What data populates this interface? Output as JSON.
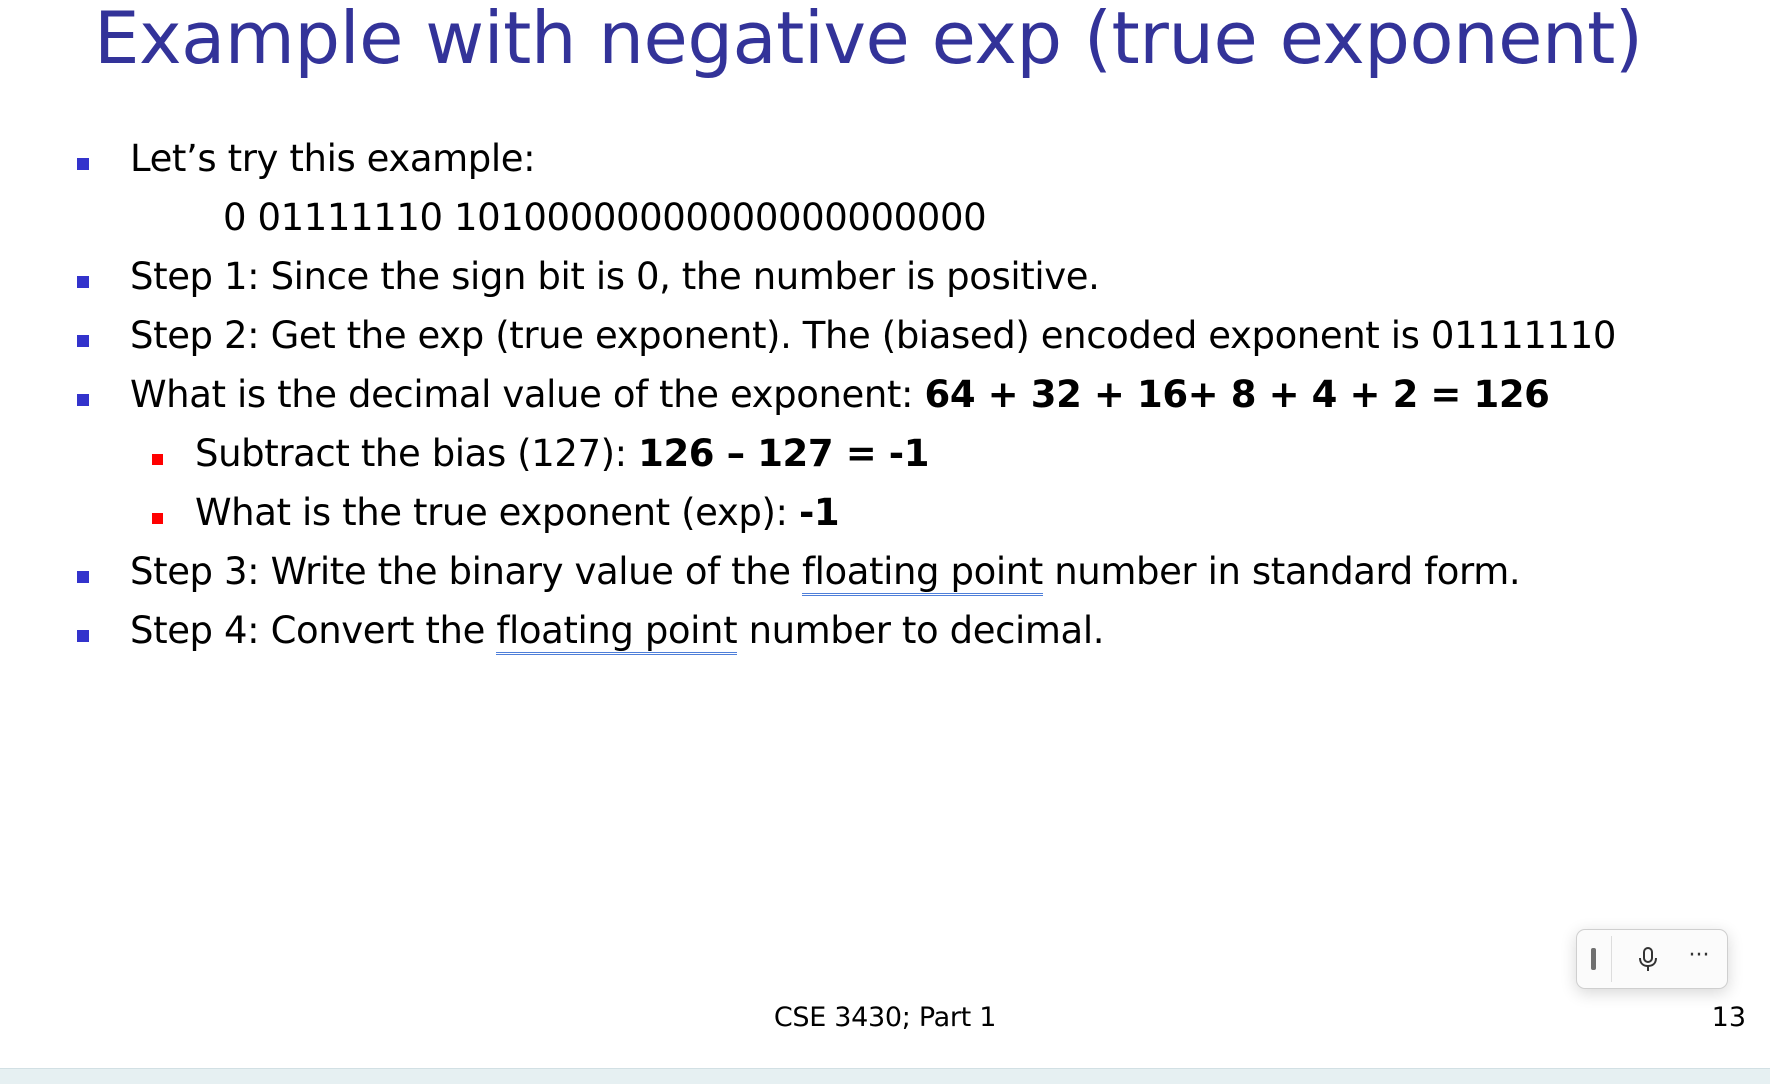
{
  "slide": {
    "title": "Example with negative exp (true exponent)",
    "bullets": {
      "b1": "Let’s try this example:",
      "example_bits": "0 01111110 10100000000000000000000",
      "b2": "Step 1: Since the sign bit is 0, the number is positive.",
      "b3": "Step 2: Get the exp (true exponent). The (biased) encoded exponent is 01111110",
      "b4_prefix": "What is the decimal value of the exponent: ",
      "b4_bold": "64 + 32 + 16+ 8 + 4 + 2 = 126",
      "sub1_prefix": "Subtract the bias (127): ",
      "sub1_bold": "126 – 127 = -1",
      "sub2_prefix": "What is the true exponent (exp): ",
      "sub2_bold": "-1",
      "b5_prefix": "Step 3: Write the binary value of the ",
      "b5_underlined": "floating point",
      "b5_suffix": " number in standard form.",
      "b6_prefix": "Step 4: Convert the ",
      "b6_underlined": "floating point",
      "b6_suffix": " number to decimal."
    },
    "footer": "CSE 3430; Part 1",
    "page_number": "13"
  },
  "dictation_toolbar": {
    "icons": [
      "drag-handle",
      "microphone-icon",
      "more-options-icon"
    ],
    "more_label": "···"
  },
  "colors": {
    "title": "#333399",
    "bullet_primary": "#3333cc",
    "bullet_secondary": "#ff0000",
    "spellcheck_underline": "#4f7fd9"
  }
}
